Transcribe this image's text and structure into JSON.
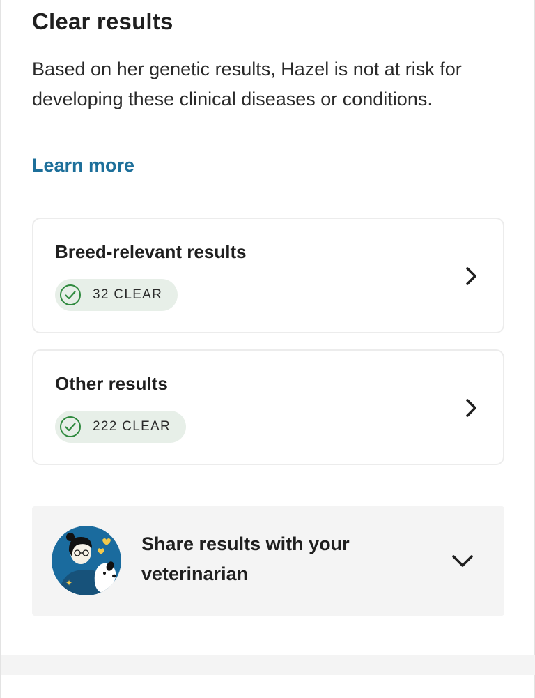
{
  "section": {
    "title": "Clear results",
    "description": "Based on her genetic results, Hazel is not at risk for developing these clinical diseases or conditions.",
    "learn_more_label": "Learn more"
  },
  "cards": [
    {
      "title": "Breed-relevant results",
      "badge": "32 CLEAR",
      "status_icon": "check-circle-icon",
      "nav_icon": "chevron-right-icon"
    },
    {
      "title": "Other results",
      "badge": "222 CLEAR",
      "status_icon": "check-circle-icon",
      "nav_icon": "chevron-right-icon"
    }
  ],
  "share": {
    "label": "Share results with your veterinarian",
    "avatar": "vet-with-dog-illustration",
    "expand_icon": "chevron-down-icon"
  },
  "colors": {
    "text": "#1f1f1f",
    "link": "#1d6f9a",
    "badge_bg": "#e7efe8",
    "badge_check": "#2f8a3e",
    "card_border": "#ececec",
    "panel_bg": "#f4f4f4",
    "avatar_bg": "#1a6b9e"
  }
}
